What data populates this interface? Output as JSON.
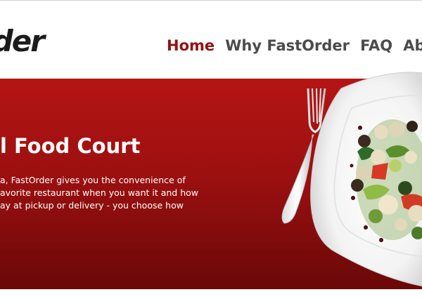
{
  "header": {
    "logo_text": "rder",
    "nav": [
      {
        "label": "Home",
        "active": true
      },
      {
        "label": "Why FastOrder",
        "active": false
      },
      {
        "label": "FAQ",
        "active": false
      },
      {
        "label": "Abo",
        "active": false
      }
    ]
  },
  "hero": {
    "title": "l Food Court",
    "body_lines": [
      "a, FastOrder gives you the convenience of",
      "avorite restaurant when you want it and how",
      "ay at pickup or delivery - you choose how"
    ]
  },
  "colors": {
    "brand_red": "#8e1414",
    "hero_red_top": "#b51414",
    "hero_red_bottom": "#6a0808",
    "nav_text": "#4b4b4b"
  },
  "icons": {
    "logo_arrow": "arrow-underline-icon",
    "fork": "fork-icon",
    "plate": "salad-plate-image"
  }
}
